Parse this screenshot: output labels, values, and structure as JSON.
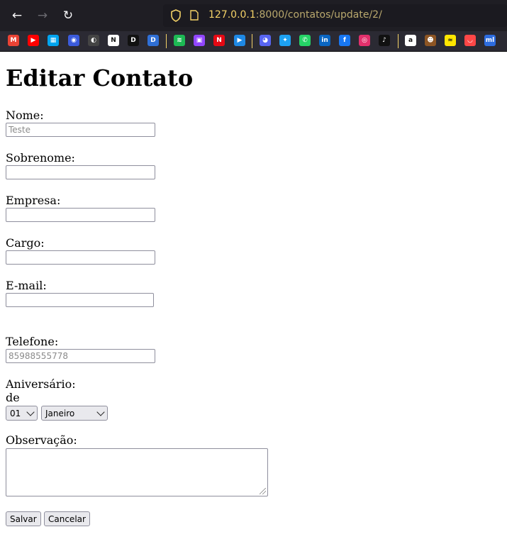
{
  "browser": {
    "url_host": "127.0.0.1",
    "url_path": ":8000/contatos/update/2/",
    "bookmarks": [
      {
        "icon": "gmail-icon",
        "color": "#ea4335",
        "glyph": "M"
      },
      {
        "icon": "youtube-icon",
        "color": "#ff0000",
        "glyph": "▶"
      },
      {
        "icon": "microsoft-icon",
        "color": "#00a4ef",
        "glyph": "▦"
      },
      {
        "icon": "mask-icon",
        "color": "#3b5bdb",
        "glyph": "◉"
      },
      {
        "icon": "github-icon",
        "color": "#444",
        "glyph": "◐"
      },
      {
        "icon": "notion-icon",
        "color": "#ffffff",
        "glyph": "N"
      },
      {
        "icon": "d-icon",
        "color": "#111111",
        "glyph": "D"
      },
      {
        "icon": "d-blue-icon",
        "color": "#2f6fd6",
        "glyph": "D"
      },
      {
        "icon": "spotify-icon",
        "color": "#1db954",
        "glyph": "≋"
      },
      {
        "icon": "twitch-icon",
        "color": "#9146ff",
        "glyph": "▣"
      },
      {
        "icon": "netflix-icon",
        "color": "#e50914",
        "glyph": "N"
      },
      {
        "icon": "play-icon",
        "color": "#1e88e5",
        "glyph": "▶"
      },
      {
        "icon": "discord-icon",
        "color": "#5865f2",
        "glyph": "◕"
      },
      {
        "icon": "twitter-icon",
        "color": "#1da1f2",
        "glyph": "✦"
      },
      {
        "icon": "whatsapp-icon",
        "color": "#25d366",
        "glyph": "✆"
      },
      {
        "icon": "linkedin-icon",
        "color": "#0a66c2",
        "glyph": "in"
      },
      {
        "icon": "facebook-icon",
        "color": "#1877f2",
        "glyph": "f"
      },
      {
        "icon": "instagram-icon",
        "color": "#e1306c",
        "glyph": "◎"
      },
      {
        "icon": "tiktok-icon",
        "color": "#111111",
        "glyph": "♪"
      },
      {
        "icon": "amazon-icon",
        "color": "#ffffff",
        "glyph": "a"
      },
      {
        "icon": "monkey-icon",
        "color": "#8d5524",
        "glyph": "☻"
      },
      {
        "icon": "mercado-livre-icon",
        "color": "#ffe600",
        "glyph": "≈"
      },
      {
        "icon": "aliexpress-icon",
        "color": "#ff4747",
        "glyph": "◡"
      },
      {
        "icon": "ml-icon",
        "color": "#2d6cdf",
        "glyph": "ml"
      },
      {
        "icon": "other-icon",
        "color": "#6c4ed8",
        "glyph": "◎"
      }
    ]
  },
  "page": {
    "title": "Editar Contato",
    "fields": {
      "nome": {
        "label": "Nome:",
        "value": "",
        "placeholder": "Teste"
      },
      "sobrenome": {
        "label": "Sobrenome:",
        "value": "",
        "placeholder": ""
      },
      "empresa": {
        "label": "Empresa:",
        "value": "",
        "placeholder": ""
      },
      "cargo": {
        "label": "Cargo:",
        "value": "",
        "placeholder": ""
      },
      "email": {
        "label": "E-mail:",
        "value": "",
        "placeholder": ""
      },
      "telefone": {
        "label": "Telefone:",
        "value": "",
        "placeholder": "85988555778"
      },
      "aniversario": {
        "label": "Aniversário:",
        "connector": "de",
        "day": "01",
        "month": "Janeiro"
      },
      "observacao": {
        "label": "Observação:"
      }
    },
    "buttons": {
      "save": "Salvar",
      "cancel": "Cancelar"
    }
  }
}
